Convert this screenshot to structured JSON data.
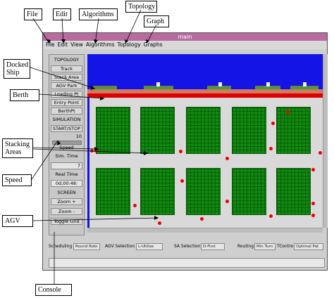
{
  "callouts": {
    "file": "File",
    "edit": "Edit",
    "algorithms": "Algorithms",
    "topology": "Topology",
    "graph": "Graph",
    "docked_ship": "Docked Ship",
    "berth": "Berth",
    "stacking_areas": "Stacking Areas",
    "speed": "Speed",
    "agv": "AGV",
    "console": "Console"
  },
  "window": {
    "title": "main",
    "menu": [
      "File",
      "Edit",
      "View",
      "Algorithms",
      "Topology",
      "Graphs"
    ]
  },
  "panel": {
    "topology_header": "TOPOLOGY",
    "track": "Track",
    "stack_area": "Stack Area",
    "agv_park": "AGV Park",
    "loading_pt": "Loading Pt",
    "entry_point": "Entry Point",
    "berth_pt": "BerthPt",
    "simulation_header": "SIMULATION",
    "start_stop": "START/STOP",
    "speed_value": "10",
    "speed_label": "Speed",
    "sim_time": "Sim. Time",
    "sim_time_value": "7",
    "real_time": "Real Time",
    "real_time_value": "0d,00:48:",
    "screen_header": "SCREEN",
    "zoom_in": "Zoom +",
    "zoom_out": "Zoom -",
    "toggle_grid": "Toggle Grid"
  },
  "bottom": {
    "scheduling_label": "Scheduling",
    "scheduling_value": "Round Robi",
    "agv_selection_label": "AGV Selection",
    "agv_selection_value": "L-Utilise",
    "sa_selection_label": "SA Selection",
    "sa_selection_value": "D-First",
    "routing_label": "Routing",
    "routing_value": "Min Turn",
    "tcontrol_label": "TContro",
    "tcontrol_value": "Optimal Pat"
  },
  "colors": {
    "sea": "#1414e6",
    "berth": "#e00000",
    "stack_block": "#0f8a0f",
    "agv": "#ee0000",
    "titlebar": "#b86b9f"
  }
}
